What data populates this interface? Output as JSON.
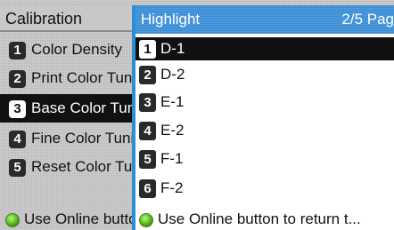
{
  "background_menu": {
    "title": "Calibration",
    "items": [
      {
        "num": "1",
        "label": "Color Density"
      },
      {
        "num": "2",
        "label": "Print Color Tuning"
      },
      {
        "num": "3",
        "label": "Base Color Tuning"
      },
      {
        "num": "4",
        "label": "Fine Color Tuning"
      },
      {
        "num": "5",
        "label": "Reset Color Tuning"
      }
    ],
    "selected_index": 2,
    "footer": "Use Online button to return"
  },
  "popup": {
    "title": "Highlight",
    "page": "2/5 Pag",
    "items": [
      {
        "num": "1",
        "label": "D-1"
      },
      {
        "num": "2",
        "label": "D-2"
      },
      {
        "num": "3",
        "label": "E-1"
      },
      {
        "num": "4",
        "label": "E-2"
      },
      {
        "num": "5",
        "label": "F-1"
      },
      {
        "num": "6",
        "label": "F-2"
      }
    ],
    "selected_index": 0,
    "footer": "Use Online button to return t..."
  },
  "colors": {
    "popup_title_bg": "#3a8ed7",
    "selection_bg": "#111111",
    "radio_icon": "#3a9a12"
  },
  "icons": {
    "radio": "online-button-icon"
  }
}
